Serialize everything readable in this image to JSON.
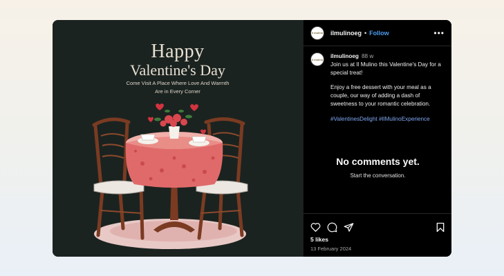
{
  "post_image": {
    "title": "Happy",
    "subtitle": "Valentine's Day",
    "tagline": "Come Visit A Place Where Love And Warmth Are in Every Corner"
  },
  "header": {
    "username": "ilmulinoeg",
    "separator": "•",
    "follow_label": "Follow",
    "more_icon": "more-horizontal-icon",
    "more_glyph": "•••"
  },
  "caption": {
    "username": "ilmulinoeg",
    "age": "88 w",
    "paragraph_1": "Join us at Il Mulino this Valentine's Day for a special treat!",
    "paragraph_2": "Enjoy a free dessert with your meal as a couple, our way of adding a dash of sweetness to your romantic celebration.",
    "hashtags": "#ValentinesDelight #IlMulinoExperience"
  },
  "comments": {
    "empty_title": "No comments yet.",
    "empty_subtitle": "Start the conversation."
  },
  "actions": {
    "icons": [
      "heart-icon",
      "comment-icon",
      "share-icon",
      "bookmark-icon"
    ],
    "likes": "5 likes",
    "date": "13 February 2024"
  },
  "colors": {
    "page_background": "#f3f0ea",
    "image_background": "#1b2320",
    "panel_background": "#000000",
    "link_blue": "#4a9df0",
    "hashtag_blue": "#7fa8f2",
    "tablecloth": "#e06a6a"
  }
}
